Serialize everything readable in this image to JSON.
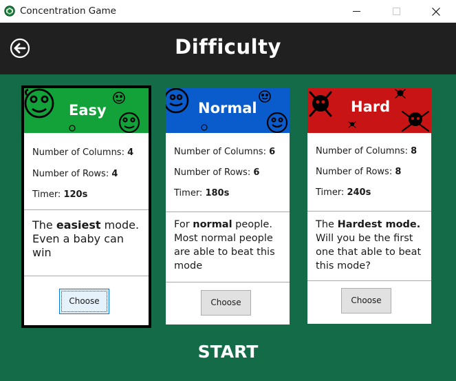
{
  "window": {
    "title": "Concentration Game"
  },
  "header": {
    "title": "Difficulty"
  },
  "cards": [
    {
      "name": "Easy",
      "banner_color": "#13a13a",
      "columns_label": "Number of Columns:",
      "columns": "4",
      "rows_label": "Number of Rows:",
      "rows": "4",
      "timer_label": "Timer:",
      "timer": "120s",
      "desc_pre": "The ",
      "desc_bold": "easiest",
      "desc_post": " mode. Even a baby can win",
      "button": "Choose",
      "selected": true
    },
    {
      "name": "Normal",
      "banner_color": "#0a5ccc",
      "columns_label": "Number of Columns:",
      "columns": "6",
      "rows_label": "Number of Rows:",
      "rows": "6",
      "timer_label": "Timer:",
      "timer": "180s",
      "desc_pre": "For ",
      "desc_bold": "normal",
      "desc_post": " people. Most normal people are able to beat this mode",
      "button": "Choose",
      "selected": false
    },
    {
      "name": "Hard",
      "banner_color": "#c81414",
      "columns_label": "Number of Columns:",
      "columns": "8",
      "rows_label": "Number of Rows:",
      "rows": "8",
      "timer_label": "Timer:",
      "timer": "240s",
      "desc_pre": "The ",
      "desc_bold": "Hardest mode.",
      "desc_post": " Will you be the first one that able to beat this mode?",
      "button": "Choose",
      "selected": false
    }
  ],
  "footer": {
    "start_label": "START"
  },
  "colors": {
    "background": "#136b48",
    "header": "#202020"
  }
}
